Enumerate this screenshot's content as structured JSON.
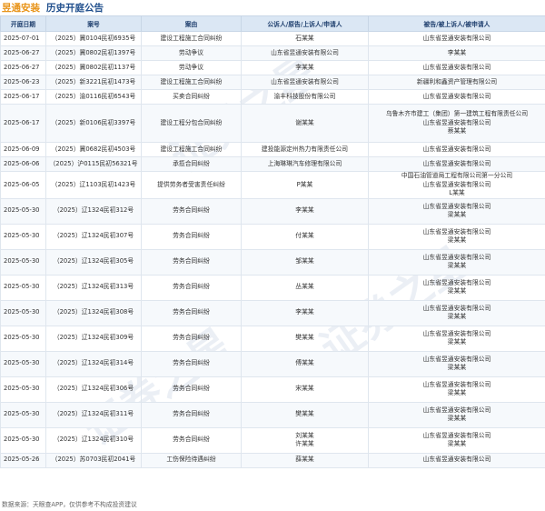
{
  "header": {
    "company": "昱通安装",
    "subtitle": "历史开庭公告"
  },
  "table": {
    "columns": [
      "开庭日期",
      "案号",
      "案由",
      "公诉人/原告/上诉人/申请人",
      "被告/被上诉人/被申请人"
    ],
    "rows": [
      {
        "date": "2025-07-01",
        "case_no": "（2025）冀0104民初6935号",
        "cause": "建设工程施工合同纠纷",
        "plaintiffs": [
          "石某某"
        ],
        "defendants": [
          "山东省昱通安装有限公司"
        ]
      },
      {
        "date": "2025-06-27",
        "case_no": "（2025）冀0802民初1397号",
        "cause": "劳动争议",
        "plaintiffs": [
          "山东省昱通安装有限公司"
        ],
        "defendants": [
          "李某某"
        ]
      },
      {
        "date": "2025-06-27",
        "case_no": "（2025）冀0802民初1137号",
        "cause": "劳动争议",
        "plaintiffs": [
          "李某某"
        ],
        "defendants": [
          "山东省昱通安装有限公司"
        ]
      },
      {
        "date": "2025-06-23",
        "case_no": "（2025）新3221民初1473号",
        "cause": "建设工程施工合同纠纷",
        "plaintiffs": [
          "山东省昱通安装有限公司"
        ],
        "defendants": [
          "新疆利和鑫资产管理有限公司"
        ]
      },
      {
        "date": "2025-06-17",
        "case_no": "（2025）渝0116民初6543号",
        "cause": "买卖合同纠纷",
        "plaintiffs": [
          "渝丰科技股份有限公司"
        ],
        "defendants": [
          "山东省昱通安装有限公司"
        ]
      },
      {
        "date": "2025-06-17",
        "case_no": "（2025）新0106民初3397号",
        "cause": "建设工程分包合同纠纷",
        "plaintiffs": [
          "谢某某"
        ],
        "defendants": [
          "乌鲁木齐市建工（集团）第一建筑工程有限责任公司",
          "山东省昱通安装有限公司",
          "蔡某某"
        ]
      },
      {
        "date": "2025-06-09",
        "case_no": "（2025）冀0682民初4503号",
        "cause": "建设工程施工合同纠纷",
        "plaintiffs": [
          "建投能源定州热力有限责任公司"
        ],
        "defendants": [
          "山东省昱通安装有限公司"
        ]
      },
      {
        "date": "2025-06-06",
        "case_no": "（2025）沪0115民初56321号",
        "cause": "承揽合同纠纷",
        "plaintiffs": [
          "上海琳琳汽车修理有限公司"
        ],
        "defendants": [
          "山东省昱通安装有限公司"
        ]
      },
      {
        "date": "2025-06-05",
        "case_no": "（2025）辽1103民初1423号",
        "cause": "提供劳务者受害责任纠纷",
        "plaintiffs": [
          "P某某"
        ],
        "defendants": [
          "中国石油管道局工程有限公司第一分公司",
          "山东省昱通安装有限公司",
          "L某某"
        ]
      },
      {
        "date": "2025-05-30",
        "case_no": "（2025）辽1324民初312号",
        "cause": "劳务合同纠纷",
        "plaintiffs": [
          "李某某"
        ],
        "defendants": [
          "山东省昱通安装有限公司",
          "梁某某"
        ]
      },
      {
        "date": "2025-05-30",
        "case_no": "（2025）辽1324民初307号",
        "cause": "劳务合同纠纷",
        "plaintiffs": [
          "付某某"
        ],
        "defendants": [
          "山东省昱通安装有限公司",
          "梁某某"
        ]
      },
      {
        "date": "2025-05-30",
        "case_no": "（2025）辽1324民初305号",
        "cause": "劳务合同纠纷",
        "plaintiffs": [
          "邹某某"
        ],
        "defendants": [
          "山东省昱通安装有限公司",
          "梁某某"
        ]
      },
      {
        "date": "2025-05-30",
        "case_no": "（2025）辽1324民初313号",
        "cause": "劳务合同纠纷",
        "plaintiffs": [
          "丛某某"
        ],
        "defendants": [
          "山东省昱通安装有限公司",
          "梁某某"
        ]
      },
      {
        "date": "2025-05-30",
        "case_no": "（2025）辽1324民初308号",
        "cause": "劳务合同纠纷",
        "plaintiffs": [
          "李某某"
        ],
        "defendants": [
          "山东省昱通安装有限公司",
          "梁某某"
        ]
      },
      {
        "date": "2025-05-30",
        "case_no": "（2025）辽1324民初309号",
        "cause": "劳务合同纠纷",
        "plaintiffs": [
          "樊某某"
        ],
        "defendants": [
          "山东省昱通安装有限公司",
          "梁某某"
        ]
      },
      {
        "date": "2025-05-30",
        "case_no": "（2025）辽1324民初314号",
        "cause": "劳务合同纠纷",
        "plaintiffs": [
          "傅某某"
        ],
        "defendants": [
          "山东省昱通安装有限公司",
          "梁某某"
        ]
      },
      {
        "date": "2025-05-30",
        "case_no": "（2025）辽1324民初306号",
        "cause": "劳务合同纠纷",
        "plaintiffs": [
          "宋某某"
        ],
        "defendants": [
          "山东省昱通安装有限公司",
          "梁某某"
        ]
      },
      {
        "date": "2025-05-30",
        "case_no": "（2025）辽1324民初311号",
        "cause": "劳务合同纠纷",
        "plaintiffs": [
          "樊某某"
        ],
        "defendants": [
          "山东省昱通安装有限公司",
          "梁某某"
        ]
      },
      {
        "date": "2025-05-30",
        "case_no": "（2025）辽1324民初310号",
        "cause": "劳务合同纠纷",
        "plaintiffs": [
          "刘某某",
          "许某某"
        ],
        "defendants": [
          "山东省昱通安装有限公司",
          "梁某某"
        ]
      },
      {
        "date": "2025-05-26",
        "case_no": "（2025）苏0703民初2041号",
        "cause": "工伤保险待遇纠纷",
        "plaintiffs": [
          "薛某某"
        ],
        "defendants": [
          "山东省昱通安装有限公司"
        ]
      }
    ]
  },
  "watermark": {
    "text": "证券之星"
  },
  "footer": {
    "source": "数据来源：天眼查APP，仅供参考不构成投资建议"
  },
  "colors": {
    "company": "#e8941a",
    "subtitle": "#1f4e8c",
    "header_bg": "#dbe7f4"
  }
}
